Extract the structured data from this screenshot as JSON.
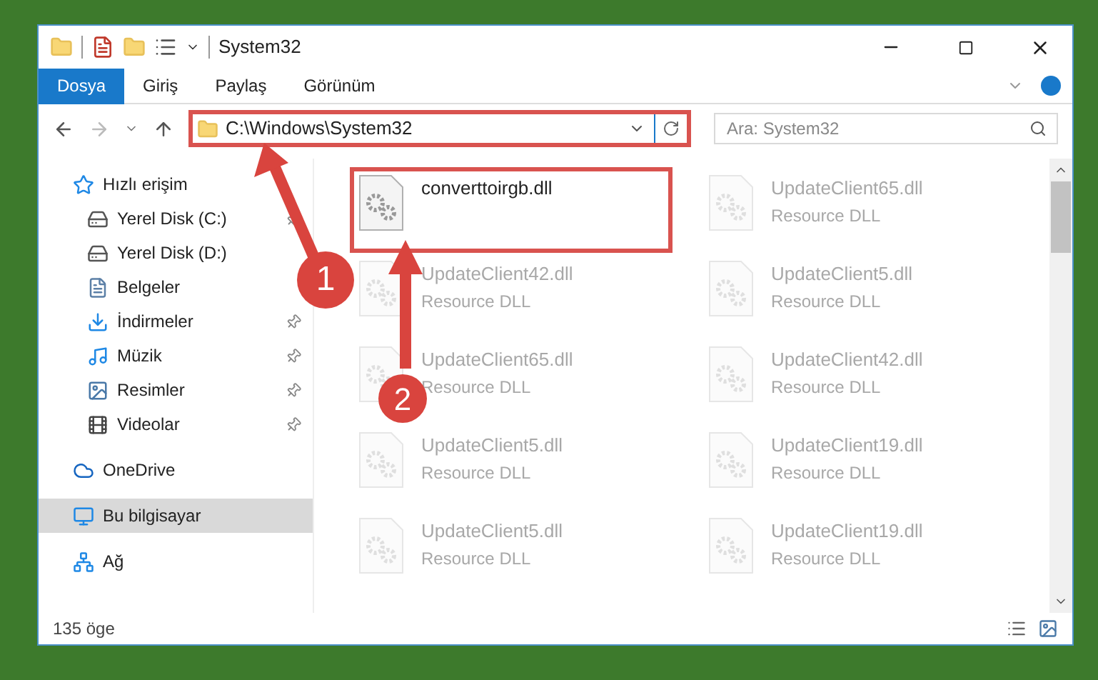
{
  "window": {
    "title": "System32"
  },
  "ribbon_tabs": [
    {
      "label": "Dosya",
      "selected": true
    },
    {
      "label": "Giriş",
      "selected": false
    },
    {
      "label": "Paylaş",
      "selected": false
    },
    {
      "label": "Görünüm",
      "selected": false
    }
  ],
  "address": {
    "path": "C:\\Windows\\System32",
    "marked": true
  },
  "search": {
    "placeholder": "Ara: System32"
  },
  "sidebar": {
    "items": [
      {
        "label": "Hızlı erişim",
        "kind": "quick",
        "selected": false,
        "children": [
          {
            "label": "Yerel Disk (C:)",
            "kind": "drive-c",
            "pinned": true,
            "selected": false
          },
          {
            "label": "Yerel Disk (D:)",
            "kind": "drive",
            "pinned": false,
            "selected": false
          },
          {
            "label": "Belgeler",
            "kind": "documents",
            "pinned": false,
            "selected": false
          },
          {
            "label": "İndirmeler",
            "kind": "downloads",
            "pinned": true,
            "selected": false
          },
          {
            "label": "Müzik",
            "kind": "music",
            "pinned": true,
            "selected": false
          },
          {
            "label": "Resimler",
            "kind": "pictures",
            "pinned": true,
            "selected": false
          },
          {
            "label": "Videolar",
            "kind": "videos",
            "pinned": true,
            "selected": false
          }
        ]
      },
      {
        "label": "OneDrive",
        "kind": "cloud",
        "selected": false
      },
      {
        "label": "Bu bilgisayar",
        "kind": "computer",
        "selected": true
      },
      {
        "label": "Ağ",
        "kind": "network",
        "selected": false
      }
    ]
  },
  "files": [
    {
      "name": "converttoirgb.dll",
      "faded": false,
      "marked": true
    },
    {
      "name": "UpdateClient65.dll",
      "type": "Resource DLL",
      "faded": true,
      "marked": false
    },
    {
      "name": "UpdateClient42.dll",
      "type": "Resource DLL",
      "faded": true,
      "marked": false
    },
    {
      "name": "UpdateClient5.dll",
      "type": "Resource DLL",
      "faded": true,
      "marked": false
    },
    {
      "name": "UpdateClient65.dll",
      "type": "Resource DLL",
      "faded": true,
      "marked": false
    },
    {
      "name": "UpdateClient42.dll",
      "type": "Resource DLL",
      "faded": true,
      "marked": false
    },
    {
      "name": "UpdateClient5.dll",
      "type": "Resource DLL",
      "faded": true,
      "marked": false
    },
    {
      "name": "UpdateClient19.dll",
      "type": "Resource DLL",
      "faded": true,
      "marked": false
    },
    {
      "name": "UpdateClient5.dll",
      "type": "Resource DLL",
      "faded": true,
      "marked": false
    },
    {
      "name": "UpdateClient19.dll",
      "type": "Resource DLL",
      "faded": true,
      "marked": false
    }
  ],
  "callouts": [
    {
      "number": "1"
    },
    {
      "number": "2"
    }
  ],
  "status_bar": {
    "count": "135 öge"
  }
}
